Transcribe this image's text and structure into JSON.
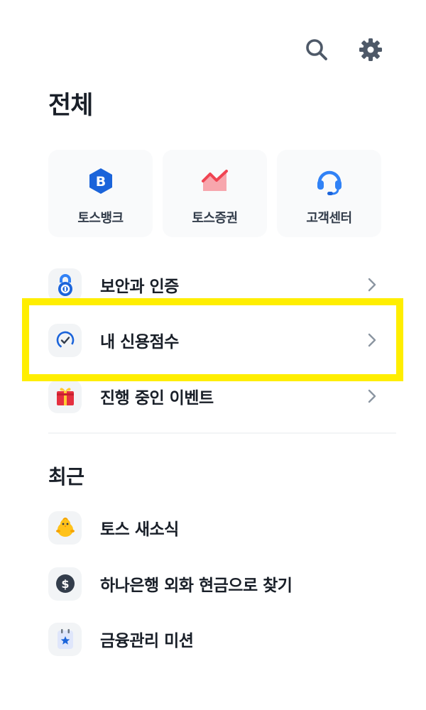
{
  "header": {
    "title": "전체",
    "search_icon": "search-icon",
    "settings_icon": "gear-icon"
  },
  "quick_links": [
    {
      "label": "토스뱅크",
      "icon": "toss-bank-icon",
      "color": "#1b64da"
    },
    {
      "label": "토스증권",
      "icon": "toss-securities-icon",
      "color": "#f04452"
    },
    {
      "label": "고객센터",
      "icon": "headset-icon",
      "color": "#3182f6"
    }
  ],
  "menu": [
    {
      "label": "보안과 인증",
      "icon": "security-lock-icon"
    },
    {
      "label": "내 신용점수",
      "icon": "credit-gauge-icon",
      "highlighted": true
    },
    {
      "label": "진행 중인 이벤트",
      "icon": "gift-icon"
    }
  ],
  "recent": {
    "title": "최근",
    "items": [
      {
        "label": "토스 새소식",
        "icon": "chick-icon"
      },
      {
        "label": "하나은행 외화 현금으로 찾기",
        "icon": "dollar-coin-icon"
      },
      {
        "label": "금융관리 미션",
        "icon": "mission-calendar-icon"
      }
    ]
  },
  "colors": {
    "highlight": "#ffee00",
    "text_primary": "#191f28",
    "card_bg": "#f9fafb",
    "icon_bg": "#f2f4f6"
  }
}
